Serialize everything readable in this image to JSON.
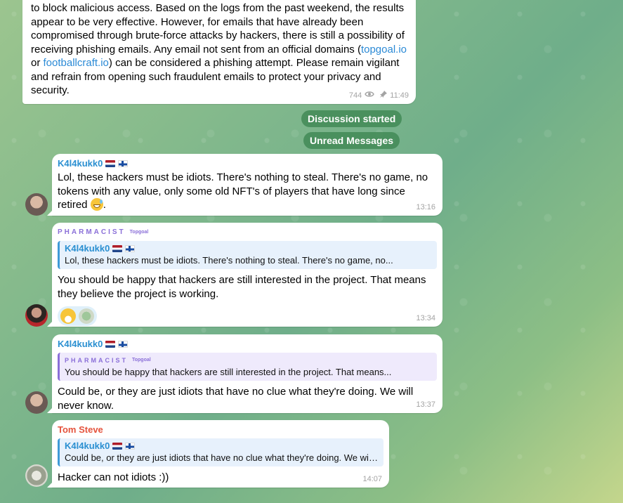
{
  "pinned_post": {
    "text_before_link1": "to block malicious access. Based on the logs from the past weekend, the results appear to be very effective. However, for emails that have already been compromised through brute-force attacks by hackers, there is still a possibility of receiving phishing emails. Any email not sent from an official domains (",
    "link1": "topgoal.io",
    "text_between": " or ",
    "link2": "footballcraft.io",
    "text_after": ") can be considered a phishing attempt. Please remain vigilant and refrain from opening such fraudulent emails to protect your privacy and security.",
    "views": "744",
    "time": "11:49"
  },
  "service": {
    "discussion_started": "Discussion started",
    "unread_messages": "Unread Messages"
  },
  "messages": [
    {
      "sender": "K4l4kukk0",
      "text": "Lol, these hackers must be idiots. There's nothing to steal. There's no game, no tokens with any value, only some old NFT's of players that have long since retired",
      "text_suffix": ".",
      "time": "13:16"
    },
    {
      "sender": "PHARMACIST",
      "sender_tag": "Topgoal",
      "reply_name": "K4l4kukk0",
      "reply_text": "Lol, these hackers must be idiots. There's nothing to steal. There's no game, no...",
      "text": "You should be happy that hackers are still interested in the project. That means they believe the project is working.",
      "time": "13:34"
    },
    {
      "sender": "K4l4kukk0",
      "reply_name": "PHARMACIST",
      "reply_tag": "Topgoal",
      "reply_text": "You should be happy that hackers are still interested in the project. That means...",
      "text": "Could be, or they are just idiots that have no clue what they're doing. We will never know.",
      "time": "13:37"
    },
    {
      "sender": "Tom Steve",
      "reply_name": "K4l4kukk0",
      "reply_text": "Could be, or they are just idiots that have no clue what they're doing. We will ...",
      "text": "Hacker can not idiots :))",
      "time": "14:07"
    }
  ],
  "colors": {
    "k4l4kukk0": "#2a8fd1",
    "pharmacist": "#8a6fd8",
    "tom_steve": "#e5533d",
    "service_bg": "#428a56"
  },
  "icons": [
    "eye-icon",
    "pin-icon",
    "grinning-sweat-emoji",
    "grinning-emoji",
    "sticker-emoji",
    "flag-netherlands-icon",
    "flag-finland-icon"
  ]
}
